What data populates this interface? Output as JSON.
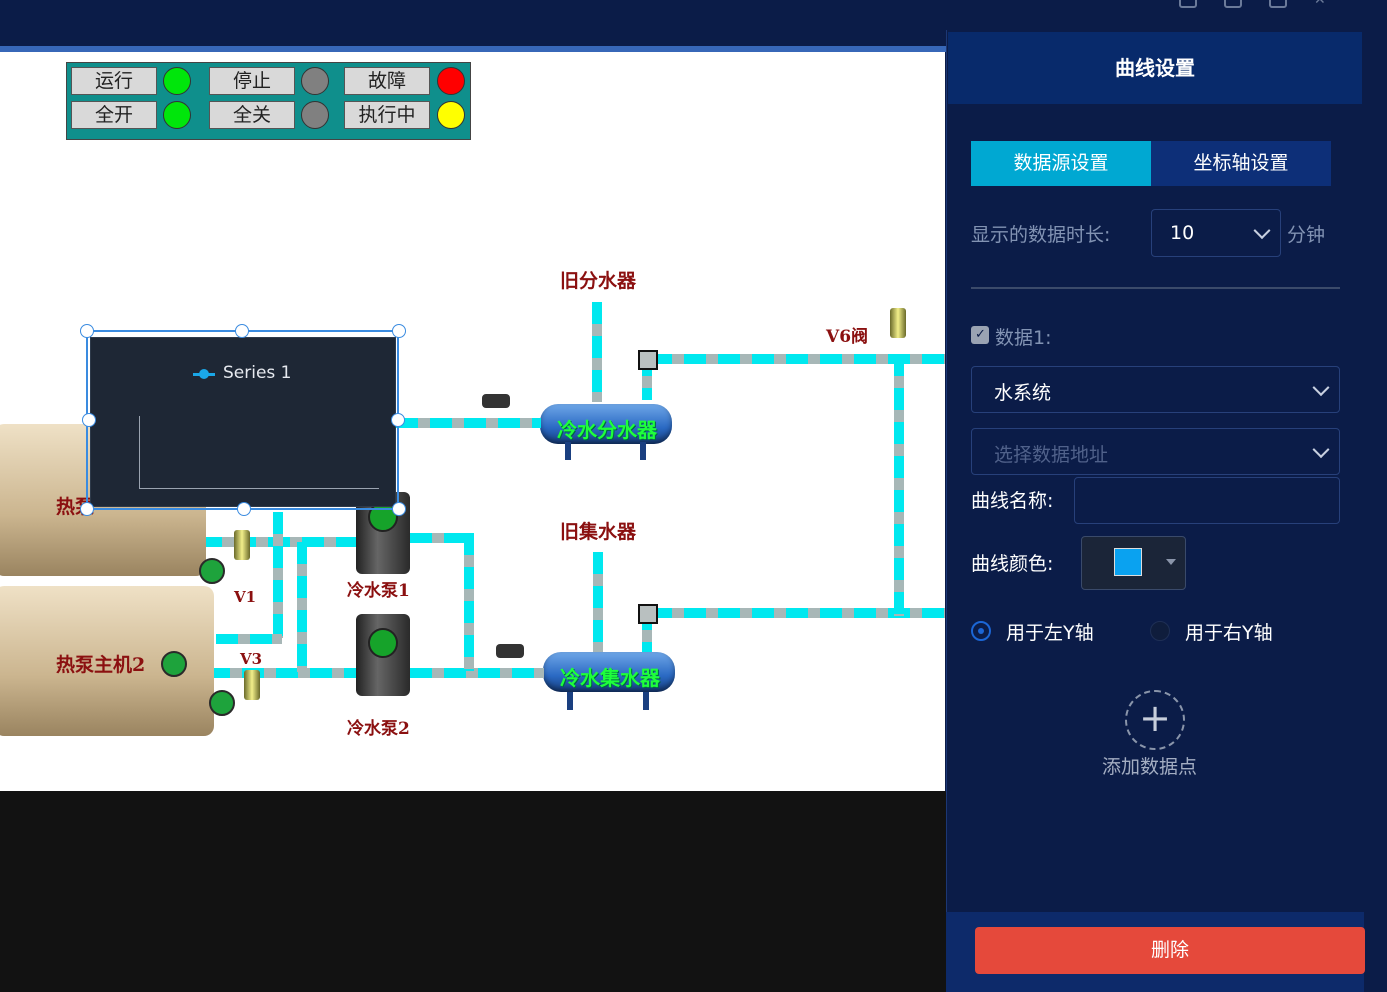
{
  "legend": {
    "items": [
      {
        "label": "运行",
        "color": "#00e60b"
      },
      {
        "label": "停止",
        "color": "#808080"
      },
      {
        "label": "故障",
        "color": "#ff0000"
      },
      {
        "label": "全开",
        "color": "#00e60b"
      },
      {
        "label": "全关",
        "color": "#808080"
      },
      {
        "label": "执行中",
        "color": "#ffff00"
      }
    ]
  },
  "diagram": {
    "old_distributor_label": "旧分水器",
    "old_collector_label": "旧集水器",
    "cold_distributor": "冷水分水器",
    "cold_collector": "冷水集水器",
    "pump1": "冷水泵1",
    "pump2": "冷水泵2",
    "heat_pump1": "热泵",
    "heat_pump2": "热泵主机2",
    "v1": "V1",
    "v3": "V3",
    "v6": "V6阀"
  },
  "chart_widget": {
    "legend_series": "Series 1"
  },
  "panel": {
    "title": "曲线设置",
    "tabs": [
      "数据源设置",
      "坐标轴设置"
    ],
    "duration_label": "显示的数据时长:",
    "duration_value": "10",
    "duration_unit": "分钟",
    "data1_label": "数据1:",
    "system_select": "水系统",
    "address_placeholder": "选择数据地址",
    "curve_name_label": "曲线名称:",
    "curve_name_value": "",
    "curve_color_label": "曲线颜色:",
    "curve_color": "#0aa2f0",
    "left_axis": "用于左Y轴",
    "right_axis": "用于右Y轴",
    "add_point": "添加数据点",
    "delete": "删除"
  },
  "colors": {
    "accent": "#00a8d2",
    "delete": "#e5493b",
    "pipe": "#00e8ef"
  }
}
